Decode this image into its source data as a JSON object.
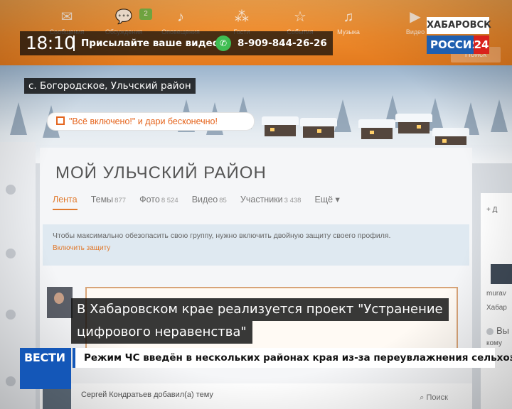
{
  "site": {
    "nav_items": [
      {
        "label": "Сообщения",
        "icon": "mail-icon"
      },
      {
        "label": "Обсуждения",
        "icon": "chat-icon",
        "badge": "2"
      },
      {
        "label": "Оповещения",
        "icon": "bell-icon"
      },
      {
        "label": "Гости",
        "icon": "footprints-icon"
      },
      {
        "label": "События",
        "icon": "star-icon"
      },
      {
        "label": "Музыка",
        "icon": "music-note-icon"
      },
      {
        "label": "Видео",
        "icon": "video-camera-icon"
      }
    ],
    "search_button": "Поиск",
    "promo_text": "\"Всё включено!\" и дари бесконечно!",
    "group_title": "МОЙ УЛЬЧСКИЙ РАЙОН",
    "tabs": [
      {
        "label": "Лента",
        "count": ""
      },
      {
        "label": "Темы",
        "count": "877"
      },
      {
        "label": "Фото",
        "count": "8 524"
      },
      {
        "label": "Видео",
        "count": "85"
      },
      {
        "label": "Участники",
        "count": "3 438"
      },
      {
        "label": "Ещё ▾",
        "count": ""
      }
    ],
    "notice_text": "Чтобы максимально обезопасить свою группу, нужно включить двойную защиту своего профиля.",
    "notice_link": "Включить защиту",
    "author_name": "Сергей Кондратьев добавил(а) тему",
    "author_search": "Поиск",
    "right_panel": {
      "line1": "+ Д",
      "line2": "murav",
      "line3": "Хабар",
      "line4": "Вы",
      "line5": "кому"
    }
  },
  "tv": {
    "clock": "18:10",
    "send_video": "Присылайте ваше видео",
    "whatsapp_icon": "whatsapp-icon",
    "phone": "8-909-844-26-26",
    "city": "ХАБАРОВСК",
    "channel_name": "РОССИЯ",
    "channel_number": "24",
    "location": "с. Богородское, Ульчский район",
    "headline_line1": "В Хабаровском крае реализуется проект \"Устранение",
    "headline_line2": "цифрового неравенства\"",
    "logo_text": "ВЕСТИ",
    "ticker": "Режим ЧС введён в нескольких районах края из-за переувлажнения сельхозугодий"
  },
  "colors": {
    "site_orange": "#ee8a2c",
    "vesti_blue": "#1457b8",
    "channel_red": "#d9221c",
    "whatsapp_green": "#3fbd53"
  }
}
